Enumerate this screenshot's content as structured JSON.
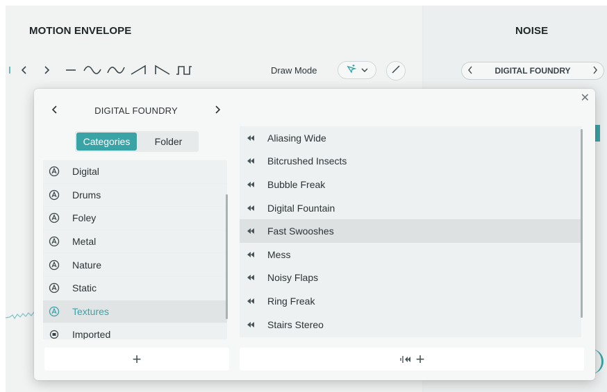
{
  "motion_envelope": {
    "title": "MOTION ENVELOPE",
    "nav_prev_icon": "chevron-left-icon",
    "nav_next_icon": "chevron-right-icon",
    "shapes": [
      "flat-line-icon",
      "sine-wave-icon",
      "reverse-sine-icon",
      "ramp-up-icon",
      "ramp-down-icon",
      "square-wave-icon"
    ],
    "draw_mode_label": "Draw Mode",
    "draw_mode_icon": "sparkle-cursor-icon"
  },
  "noise": {
    "title": "NOISE",
    "library": "DIGITAL FOUNDRY"
  },
  "browser": {
    "library_name": "DIGITAL FOUNDRY",
    "tabs": {
      "categories": "Categories",
      "folder": "Folder"
    },
    "categories": [
      {
        "label": "Digital"
      },
      {
        "label": "Drums"
      },
      {
        "label": "Foley"
      },
      {
        "label": "Metal"
      },
      {
        "label": "Nature"
      },
      {
        "label": "Static"
      },
      {
        "label": "Textures"
      },
      {
        "label": "Imported"
      }
    ],
    "selected_category": "Textures",
    "presets": [
      {
        "label": "Aliasing Wide"
      },
      {
        "label": "Bitcrushed Insects"
      },
      {
        "label": "Bubble Freak"
      },
      {
        "label": "Digital Fountain"
      },
      {
        "label": "Fast Swooshes"
      },
      {
        "label": "Mess"
      },
      {
        "label": "Noisy Flaps"
      },
      {
        "label": "Ring Freak"
      },
      {
        "label": "Stairs Stereo"
      }
    ],
    "selected_preset": "Fast Swooshes",
    "add_category_label": "+",
    "add_preset_label": "+"
  },
  "colors": {
    "accent": "#3aa3a6",
    "text": "#2b3336",
    "selected_row": "#dde1e2"
  }
}
